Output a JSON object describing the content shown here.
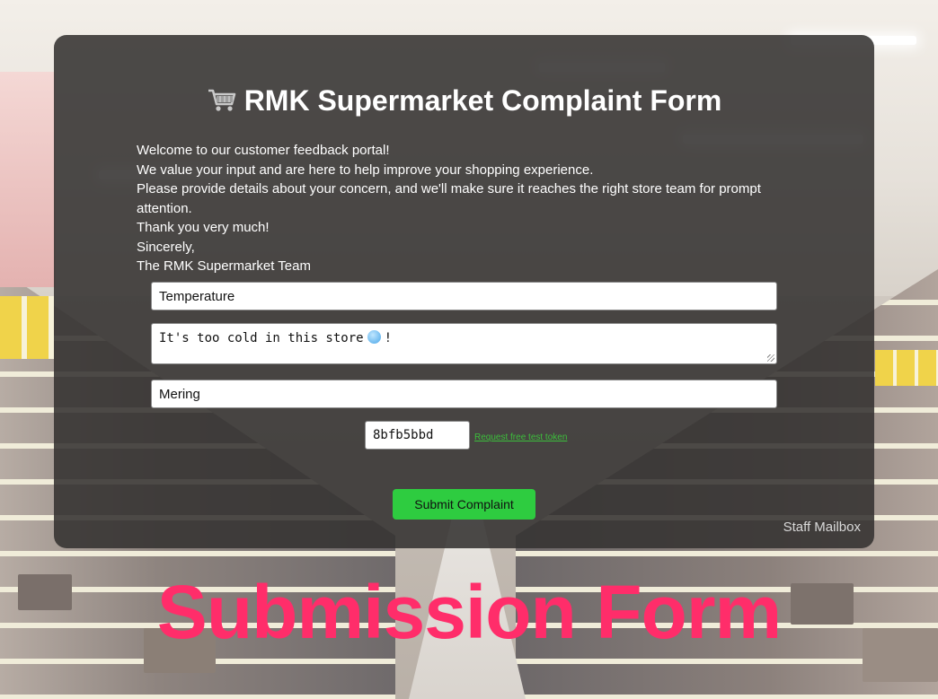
{
  "form": {
    "title": "RMK Supermarket Complaint Form",
    "title_icon": "shopping-cart-icon",
    "intro_lines": [
      "Welcome to our customer feedback portal!",
      "We value your input and are here to help improve your shopping experience.",
      "Please provide details about your concern, and we'll make sure it reaches the right store team for prompt attention.",
      "Thank you very much!",
      "Sincerely,",
      "The RMK Supermarket Team"
    ],
    "subject_value": "Temperature",
    "message_text_before": "It's too cold in this store",
    "message_emoji": "freezing-face-icon",
    "message_text_after": "!",
    "location_value": "Mering",
    "token_value": "8bfb5bbd",
    "token_link_label": "Request free test token",
    "submit_label": "Submit Complaint",
    "staff_mailbox_label": "Staff Mailbox"
  },
  "overlay": {
    "heading": "Submission Form"
  },
  "colors": {
    "accent_pink": "#ff2d6a",
    "submit_green": "#2ecc40",
    "link_green": "#3cbf3c",
    "card_bg": "#343231"
  }
}
